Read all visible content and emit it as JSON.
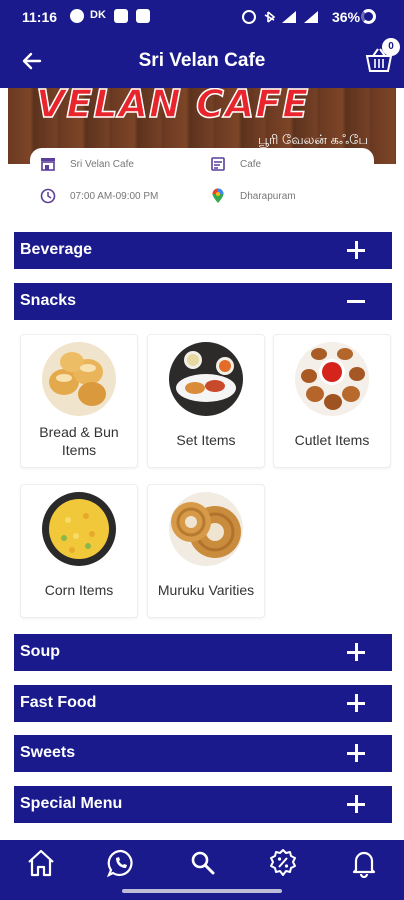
{
  "status_bar": {
    "time": "11:16",
    "battery": "36%",
    "dk_label": "DK"
  },
  "app_bar": {
    "title": "Sri Velan Cafe",
    "cart_count": "0"
  },
  "banner": {
    "logo_text": "VELAN CAFE",
    "tamil_text": "பூரி வேலன் கஃபே"
  },
  "info": {
    "name": "Sri Velan Cafe",
    "type": "Cafe",
    "hours": "07:00 AM-09:00 PM",
    "location": "Dharapuram"
  },
  "categories": [
    {
      "label": "Beverage",
      "expanded": false
    },
    {
      "label": "Snacks",
      "expanded": true
    },
    {
      "label": "Soup",
      "expanded": false
    },
    {
      "label": "Fast Food",
      "expanded": false
    },
    {
      "label": "Sweets",
      "expanded": false
    },
    {
      "label": "Special Menu",
      "expanded": false
    }
  ],
  "snack_items": [
    {
      "line1": "Bread & Bun",
      "line2": "Items"
    },
    {
      "line1": "Set Items"
    },
    {
      "line1": "Cutlet Items"
    },
    {
      "line1": "Corn Items"
    },
    {
      "line1": "Muruku Varities"
    }
  ],
  "bottom_nav": [
    "home-icon",
    "whatsapp-icon",
    "search-icon",
    "offers-icon",
    "notifications-icon"
  ],
  "colors": {
    "primary": "#1a1a8c",
    "banner_red": "#e8242c"
  }
}
